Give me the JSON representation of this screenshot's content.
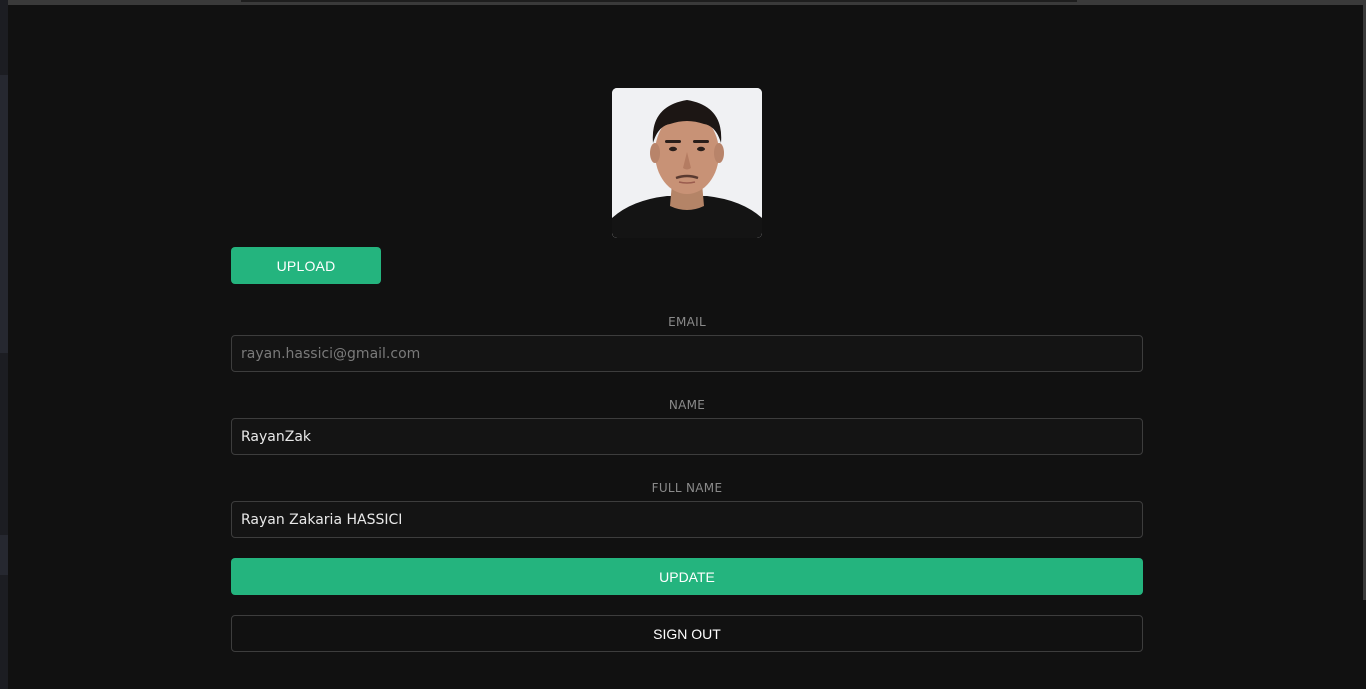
{
  "profile": {
    "avatar_alt": "profile photo",
    "upload_label": "UPLOAD"
  },
  "form": {
    "email": {
      "label": "EMAIL",
      "value": "rayan.hassici@gmail.com"
    },
    "name": {
      "label": "NAME",
      "value": "RayanZak"
    },
    "full_name": {
      "label": "FULL NAME",
      "value": "Rayan Zakaria HASSICI"
    }
  },
  "actions": {
    "update_label": "UPDATE",
    "signout_label": "SIGN OUT"
  },
  "colors": {
    "accent": "#24b47e",
    "background": "#111111",
    "input_border": "#3d3d3d"
  }
}
